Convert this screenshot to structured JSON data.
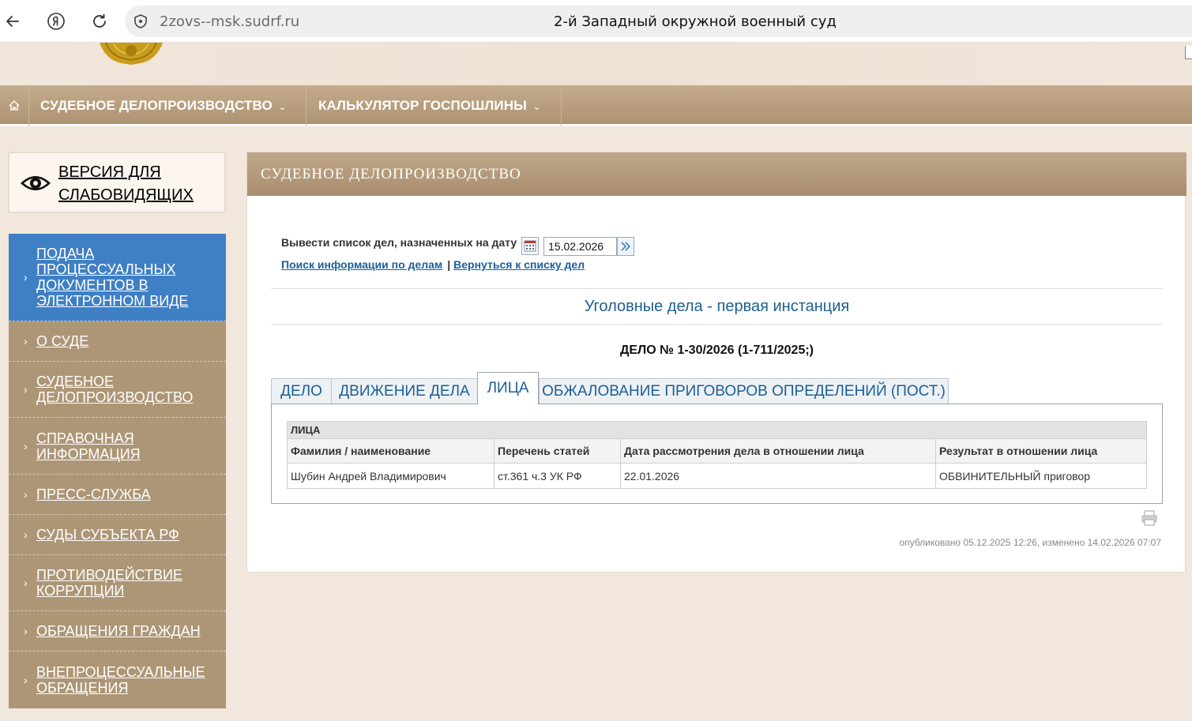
{
  "browser": {
    "url": "2zovs--msk.sudrf.ru",
    "page_title": "2-й Западный окружной военный суд",
    "back_icon": "arrow-left-icon",
    "yandex_icon": "yandex-icon",
    "reload_icon": "reload-icon",
    "security_icon": "shield-icon"
  },
  "topnav": {
    "home_icon": "home-icon",
    "items": [
      {
        "label": "СУДЕБНОЕ ДЕЛОПРОИЗВОДСТВО",
        "chevron": "⌄"
      },
      {
        "label": "КАЛЬКУЛЯТОР ГОСПОШЛИНЫ",
        "chevron": "⌄"
      }
    ]
  },
  "vision": {
    "line1": "ВЕРСИЯ ДЛЯ",
    "line2": "СЛАБОВИДЯЩИХ",
    "icon": "eye-icon"
  },
  "sidebar": {
    "arrow": "›",
    "items": [
      {
        "label": "Подача процессуальных документов в электронном виде",
        "active": true
      },
      {
        "label": "О суде",
        "active": false
      },
      {
        "label": "Судебное делопроизводство",
        "active": false
      },
      {
        "label": "Справочная информация",
        "active": false
      },
      {
        "label": "Пресс-служба",
        "active": false
      },
      {
        "label": "Суды субъекта РФ",
        "active": false
      },
      {
        "label": "Противодействие коррупции",
        "active": false
      },
      {
        "label": "Обращения граждан",
        "active": false
      },
      {
        "label": "Внепроцессуальные обращения",
        "active": false
      }
    ]
  },
  "panel": {
    "title": "СУДЕБНОЕ ДЕЛОПРОИЗВОДСТВО",
    "date_filter_label": "Вывести список дел, назначенных на дату",
    "date_value": "15.02.2026",
    "link_search": "Поиск информации по делам",
    "link_separator": "|",
    "link_back": "Вернуться к списку дел",
    "category": "Уголовные дела - первая инстанция",
    "case_number": "ДЕЛО № 1-30/2026 (1-711/2025;)",
    "tabs": [
      "ДЕЛО",
      "ДВИЖЕНИЕ ДЕЛА",
      "ЛИЦА",
      "ОБЖАЛОВАНИЕ ПРИГОВОРОВ ОПРЕДЕЛЕНИЙ (ПОСТ.)"
    ],
    "active_tab": "ЛИЦА",
    "table": {
      "caption": "ЛИЦА",
      "headers": [
        "Фамилия / наименование",
        "Перечень статей",
        "Дата рассмотрения дела в отношении лица",
        "Результат в отношении лица"
      ],
      "rows": [
        [
          "Шубин Андрей Владимирович",
          "ст.361 ч.3 УК РФ",
          "22.01.2026",
          "ОБВИНИТЕЛЬНЫЙ приговор"
        ]
      ]
    },
    "published": "опубликовано 05.12.2025 12:26, изменено 14.02.2026 07:07",
    "print_icon": "printer-icon"
  },
  "colors": {
    "nav_bg": "#ad9372",
    "sidebar_bg": "#ad9676",
    "sidebar_active": "#3f7fc4",
    "link": "#1a5f9a"
  }
}
